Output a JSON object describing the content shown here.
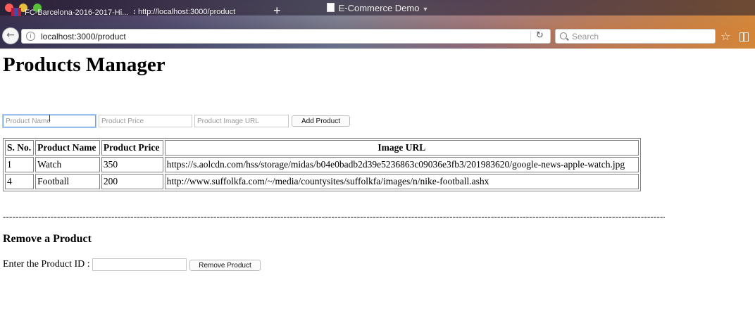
{
  "browser": {
    "window_title": "E-Commerce Demo",
    "tabs": [
      {
        "label": "FC-Barcelona-2016-2017-Hi..."
      },
      {
        "label": "http://localhost:3000/product"
      }
    ],
    "new_tab_label": "+",
    "url": "localhost:3000/product",
    "search_placeholder": "Search"
  },
  "page": {
    "title": "Products Manager",
    "add_form": {
      "name_placeholder": "Product Name",
      "price_placeholder": "Product Price",
      "image_placeholder": "Product Image URL",
      "add_button": "Add Product"
    },
    "table": {
      "headers": [
        "S. No.",
        "Product Name",
        "Product Price",
        "Image URL"
      ],
      "rows": [
        [
          "1",
          "Watch",
          "350",
          "https://s.aolcdn.com/hss/storage/midas/b04e0badb2d39e5236863c09036e3fb3/201983620/google-news-apple-watch.jpg"
        ],
        [
          "4",
          "Football",
          "200",
          "http://www.suffolkfa.com/~/media/countysites/suffolkfa/images/n/nike-football.ashx"
        ]
      ]
    },
    "separator": "--------------------------------------------------------------------------------------------------------------------------------------------------------------------------------------------------------------------------------------------------------------",
    "remove_section": {
      "heading": "Remove a Product",
      "label": "Enter the Product ID :",
      "input_value": "",
      "remove_button": "Remove Product"
    }
  },
  "colors": {
    "focus_ring": "#6ea0e0",
    "traffic_close": "#fc5b57",
    "traffic_minimize": "#e5bf3c",
    "traffic_maximize": "#57c038"
  }
}
